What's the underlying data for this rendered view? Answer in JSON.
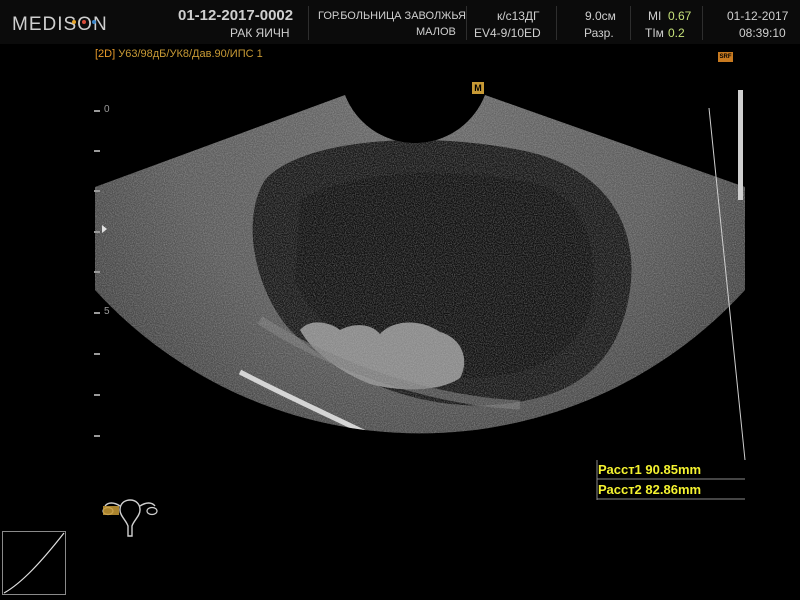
{
  "brand": {
    "name": "MEDISON",
    "dot_colors": [
      "#e3a32b",
      "#d94c3a",
      "#3c86c9"
    ]
  },
  "patient": {
    "id": "01-12-2017-0002",
    "diagnosis": "РАК ЯИЧН"
  },
  "institution": {
    "hospital": "ГОР.БОЛЬНИЦА ЗАВОЛЖЬЯ",
    "doctor": "МАЛОВ"
  },
  "probe": {
    "preset": "к/с13ДГ",
    "model": "EV4-9/10ED"
  },
  "depth": {
    "value": "9.0см",
    "label": "Разр."
  },
  "indices": {
    "mi_label": "MI",
    "mi_value": "0.67",
    "ti_label": "TIм",
    "ti_value": "0.2"
  },
  "datetime": {
    "date": "01-12-2017",
    "time": "08:39:10"
  },
  "imaging_params": {
    "mode": "[2D]",
    "settings": "У63/98дБ/УК8/Дав.90/",
    "ips": "ИПС 1"
  },
  "scale_marks": {
    "top": "0",
    "mid": "5"
  },
  "measurements": [
    {
      "label": "Расст1",
      "value": "90.85mm"
    },
    {
      "label": "Расст2",
      "value": "82.86mm"
    }
  ],
  "orientation_marker": "M",
  "srf_badge": "SRF"
}
